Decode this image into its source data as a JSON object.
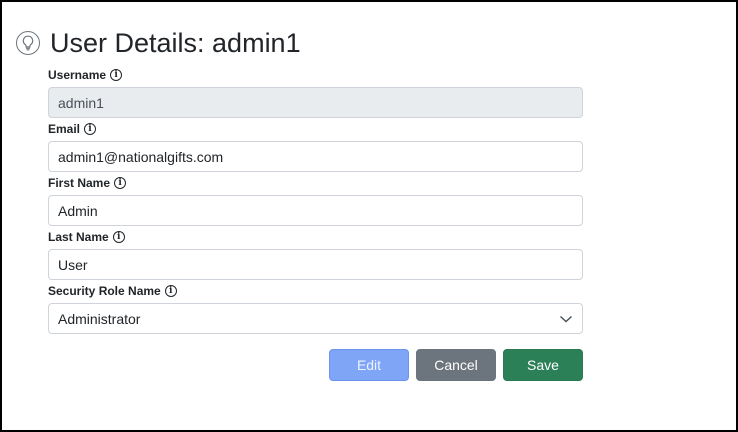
{
  "header": {
    "title": "User Details: admin1",
    "icon": "lightbulb-icon"
  },
  "form": {
    "username": {
      "label": "Username",
      "value": "admin1"
    },
    "email": {
      "label": "Email",
      "value": "admin1@nationalgifts.com"
    },
    "first_name": {
      "label": "First Name",
      "value": "Admin"
    },
    "last_name": {
      "label": "Last Name",
      "value": "User"
    },
    "security_role": {
      "label": "Security Role Name",
      "value": "Administrator"
    }
  },
  "actions": {
    "edit": "Edit",
    "cancel": "Cancel",
    "save": "Save"
  },
  "colors": {
    "edit": "#7fa5f7",
    "cancel": "#6c757d",
    "save": "#2c8057",
    "readonly_bg": "#e9ecef"
  }
}
